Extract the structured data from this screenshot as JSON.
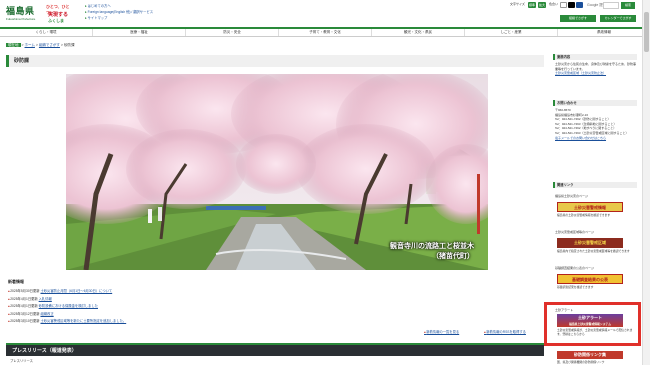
{
  "header": {
    "logo_text": "福島県",
    "logo_sub": "Fukushima Prefecture",
    "badge_lines": [
      "ひとつ、ひとつ、",
      "実現する",
      "ふくしま"
    ],
    "links": [
      "はじめての方へ",
      "Foreign language(English 他) / 翻訳サービス",
      "サイトマップ"
    ],
    "top_buttons": [
      "文字サイズ",
      "標準",
      "拡大",
      "色合い"
    ],
    "search_label": "Google 提供",
    "search_placeholder": "",
    "search_button": "検索",
    "menu_buttons": [
      "組織でさがす",
      "カレンダーでさがす"
    ]
  },
  "nav": {
    "items": [
      "くらし・環境",
      "医療・福祉",
      "防災・安全",
      "子育て・教育・文化",
      "観光・文化・県民",
      "しごと・産業",
      "県政情報"
    ]
  },
  "breadcrumb": {
    "current_badge": "現在地",
    "items": [
      "ホーム",
      "組織でさがす",
      "砂防課"
    ],
    "separator": ">"
  },
  "page_title": "砂防課",
  "hero": {
    "caption_line1": "観音寺川の流路工と桜並木",
    "caption_line2": "（猪苗代町）"
  },
  "news": {
    "heading": "新着情報",
    "items": [
      {
        "date": "2025年5月30日更新",
        "title": "土砂災害防止月間（6月1日～6月30日）について"
      },
      {
        "date": "2025年4月1日更新",
        "title": "入札情報"
      },
      {
        "date": "2025年4月1日更新",
        "title": "砂防設備における保険金を検討しました"
      },
      {
        "date": "2025年3月12日更新",
        "title": "組織改正"
      },
      {
        "date": "2025年3月10日更新",
        "title": "土砂災害警戒区域等を新たに土要所指定を追加しました。"
      }
    ],
    "more_links": [
      "新着情報の一覧を見る",
      "新着情報のRSSを取得する"
    ]
  },
  "press": {
    "title": "プレスリリース（報道発表）",
    "sub": "プレスリリース"
  },
  "sidebar": {
    "section1_title": "業務内容",
    "section1_text": "土砂災害から住民の生命、身体及び財産を守るため、砂防事業等を行っています。",
    "section1_link": "土砂災害警戒区域（土砂災害防止法）",
    "section2_title": "お問い合わせ",
    "contact_lines": [
      "〒960-8670",
      "福島県福島市杉妻町2-16",
      "Tel：024-521-7492（砂防に関すること）",
      "Tel：024-521-7493（急傾斜地に関すること）",
      "Tel：024-521-7492（地すべりに関すること）",
      "Tel：024-521-7493（土砂災害警戒区域に関すること）"
    ],
    "contact_link": "電子メールでのお問い合わせはこちら",
    "section3_title": "関連リンク",
    "link1_label": "福島県土砂災害のページ",
    "banner1_text": "土砂災害警戒情報",
    "banner1_caption": "福島県の土砂災害警戒情報を確認できます",
    "link2_label": "土砂災害警戒区域等のページ",
    "banner2_text": "土砂災害警戒区域",
    "banner2_caption": "福島県内で指定された土砂災害警戒区域等を確認できます",
    "link3_label": "基礎調査結果の公表のページ",
    "banner3_text": "基礎調査結果の公表",
    "banner3_caption": "基礎調査結果を確認できます",
    "link4_label": "土砂アラート",
    "banner4_text": "土砂アラート",
    "banner4_sub": "福島県土砂災害警戒情報システム",
    "banner4_caption": "土砂災害警戒情報が、土砂災害警戒情報メールで配信されます。登録はこちらから",
    "banner5_text": "砂防関係リンク集",
    "banner5_caption": "国、県及び関係機関の砂防関係リンク"
  },
  "colors": {
    "brand_green": "#2a8a3a",
    "link_blue": "#1a4f9a",
    "alert_red": "#e0302a",
    "press_bar": "#2a2f33"
  }
}
